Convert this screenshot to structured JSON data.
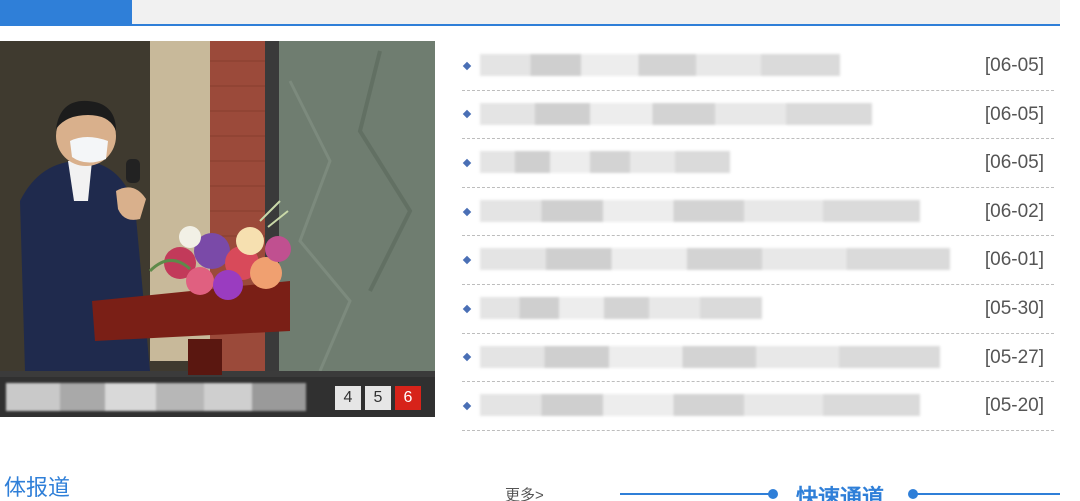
{
  "tabbar": {
    "active_tab_label": ""
  },
  "slider": {
    "caption": "",
    "pages": [
      "4",
      "5",
      "6"
    ],
    "active_page": "6"
  },
  "news": {
    "items": [
      {
        "title": "",
        "date": "[06-05]"
      },
      {
        "title": "",
        "date": "[06-05]"
      },
      {
        "title": "",
        "date": "[06-05]"
      },
      {
        "title": "",
        "date": "[06-02]"
      },
      {
        "title": "",
        "date": "[06-01]"
      },
      {
        "title": "",
        "date": "[05-30]"
      },
      {
        "title": "",
        "date": "[05-27]"
      },
      {
        "title": "",
        "date": "[05-20]"
      }
    ]
  },
  "bottom": {
    "left_section_title": "体报道",
    "more_label": "更多>",
    "quick_channel_title": "快速通道"
  },
  "colors": {
    "accent": "#2f7fd8",
    "pager_active": "#d7231a"
  }
}
